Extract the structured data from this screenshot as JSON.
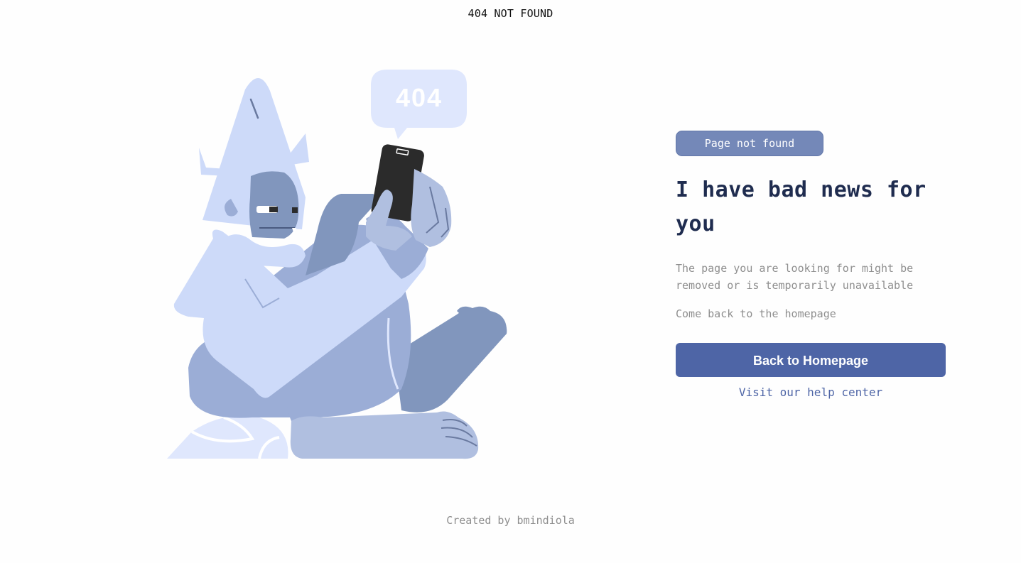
{
  "page": {
    "title": "404 NOT FOUND"
  },
  "illustration": {
    "bubble_text": "404",
    "icon": "yeti-with-phone-illustration",
    "colors": {
      "light": "#cddaf9",
      "mid": "#9badd6",
      "dark": "#8196bd",
      "phone": "#2b2b2b",
      "bubble": "#dfe7fd"
    }
  },
  "content": {
    "badge": "Page not found",
    "headline": "I have bad news for you",
    "description": "The page you are looking for might be removed or is temporarily unavailable",
    "come_back": "Come back to the homepage",
    "cta_label": "Back to Homepage",
    "help_link": "Visit our help center"
  },
  "footer": {
    "credit": "Created by bmindiola"
  },
  "theme": {
    "accent": "#4e65a6",
    "badge_bg": "#7488b8",
    "heading": "#1f2c4f",
    "muted_text": "#8e8e8e"
  }
}
